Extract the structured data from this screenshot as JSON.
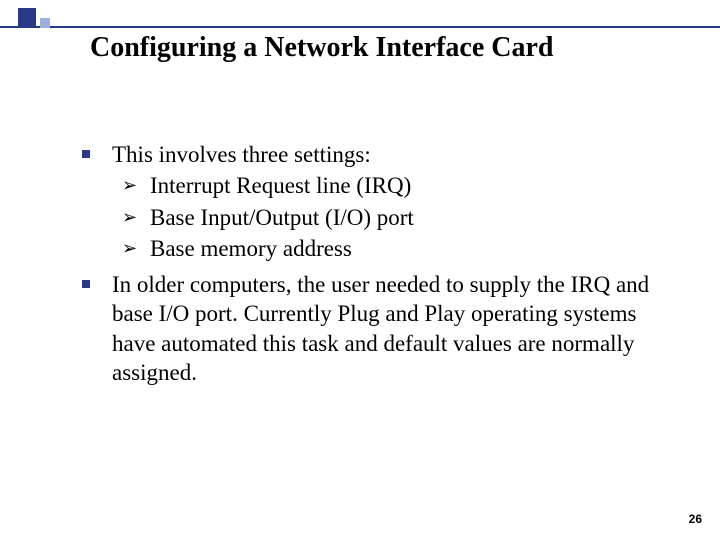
{
  "title": "Configuring a Network Interface Card",
  "bullets": [
    {
      "text": "This involves three settings:",
      "sub": [
        "Interrupt Request line (IRQ)",
        "Base Input/Output (I/O) port",
        "Base memory address"
      ]
    },
    {
      "text": "In older computers, the user needed to supply the IRQ and base I/O port. Currently Plug and Play operating systems have automated this task and default values are normally assigned.",
      "sub": []
    }
  ],
  "page_number": "26"
}
